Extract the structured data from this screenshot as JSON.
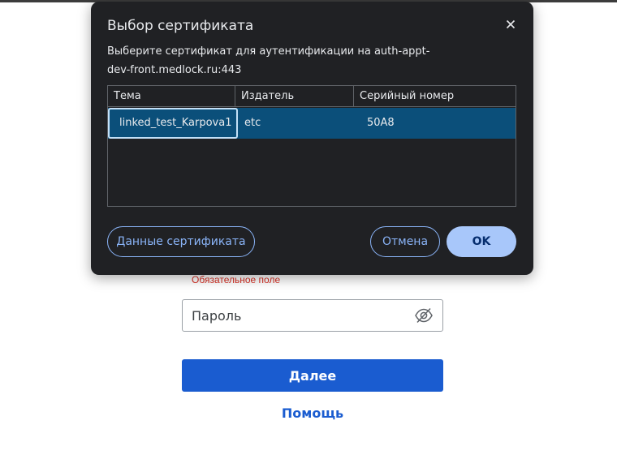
{
  "login_form": {
    "error_text": "Обязательное поле",
    "password_placeholder": "Пароль",
    "password_icon": "eye-off-icon",
    "next_label": "Далее",
    "help_label": "Помощь"
  },
  "dialog": {
    "title": "Выбор сертификата",
    "description": "Выберите сертификат для аутентификации на auth-appt-dev-front.medlock.ru:443",
    "close_icon": "close-icon",
    "table": {
      "columns": [
        "Тема",
        "Издатель",
        "Серийный номер"
      ],
      "rows": [
        {
          "subject": "linked_test_Karpova1",
          "issuer": "etc",
          "serial": "50A8",
          "selected": true
        }
      ]
    },
    "details_label": "Данные сертификата",
    "cancel_label": "Отмена",
    "ok_label": "OK"
  },
  "colors": {
    "dialog_bg": "#202124",
    "selected_row": "#0b4f7a",
    "accent": "#8ab4f8",
    "ok_bg": "#a8c7fa",
    "primary_button": "#1a5cd0",
    "error": "#d93025"
  }
}
